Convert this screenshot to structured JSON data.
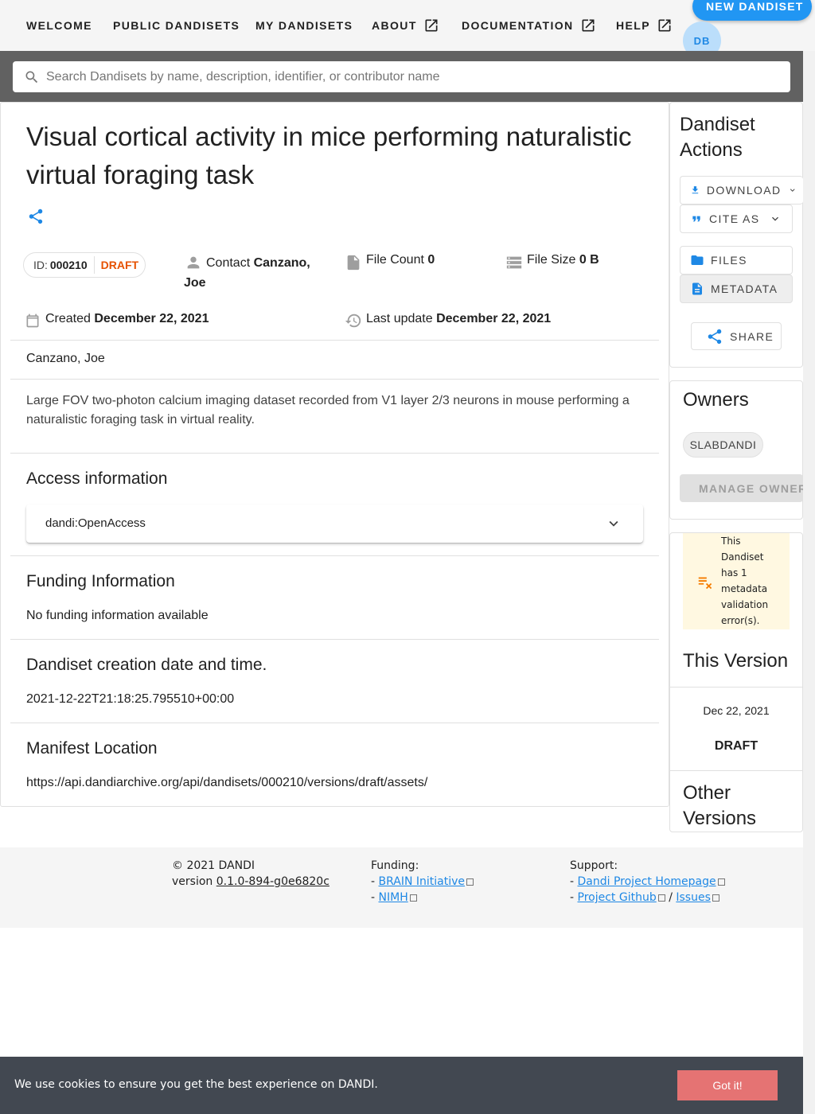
{
  "nav": {
    "items": [
      "WELCOME",
      "PUBLIC DANDISETS",
      "MY DANDISETS",
      "ABOUT",
      "DOCUMENTATION",
      "HELP"
    ],
    "new_dandiset": "NEW DANDISET",
    "avatar_initials": "DB"
  },
  "search": {
    "placeholder": "Search Dandisets by name, description, identifier, or contributor name"
  },
  "dandiset": {
    "title": "Visual cortical activity in mice performing naturalistic virtual foraging task",
    "id_label": "ID:",
    "id": "000210",
    "status": "DRAFT",
    "contact_label": "Contact",
    "contact_name": "Canzano, Joe",
    "file_count_label": "File Count",
    "file_count": "0",
    "file_size_label": "File Size",
    "file_size": "0 B",
    "created_label": "Created",
    "created": "December 22, 2021",
    "updated_label": "Last update",
    "updated": "December 22, 2021",
    "contributors": "Canzano, Joe",
    "description": "Large FOV two-photon calcium imaging dataset recorded from V1 layer 2/3 neurons in mouse performing a naturalistic foraging task in virtual reality."
  },
  "sections": {
    "access_title": "Access information",
    "access_value": "dandi:OpenAccess",
    "funding_title": "Funding Information",
    "funding_value": "No funding information available",
    "creation_title": "Dandiset creation date and time.",
    "creation_value": "2021-12-22T21:18:25.795510+00:00",
    "manifest_title": "Manifest Location",
    "manifest_value": "https://api.dandiarchive.org/api/dandisets/000210/versions/draft/assets/"
  },
  "actions": {
    "title": "Dandiset Actions",
    "download": "DOWNLOAD",
    "cite": "CITE AS",
    "files": "FILES",
    "metadata": "METADATA",
    "share": "SHARE"
  },
  "owners": {
    "title": "Owners",
    "owner": "SLABDANDI",
    "manage": "MANAGE OWNERS"
  },
  "validation": {
    "message": "This Dandiset has 1 metadata validation error(s)."
  },
  "version": {
    "title": "This Version",
    "date": "Dec 22, 2021",
    "status": "DRAFT",
    "other_title": "Other Versions"
  },
  "footer": {
    "copyright": "© 2021 DANDI",
    "version_label": "version",
    "version": "0.1.0-894-g0e6820c",
    "funding_label": "Funding:",
    "funding_links": [
      "BRAIN Initiative",
      "NIMH"
    ],
    "support_label": "Support:",
    "support_links": [
      "Dandi Project Homepage",
      "Project Github",
      "Issues"
    ],
    "dash": "-",
    "slash": "/"
  },
  "cookie": {
    "message": "We use cookies to ensure you get the best experience on DANDI.",
    "button": "Got it!"
  },
  "colors": {
    "primary": "#2196f3",
    "draft": "#e65100",
    "warning_bg": "#fff8e1",
    "warning_icon": "#f57c00",
    "cookie_bg": "#424851",
    "cookie_button": "#e57373"
  }
}
